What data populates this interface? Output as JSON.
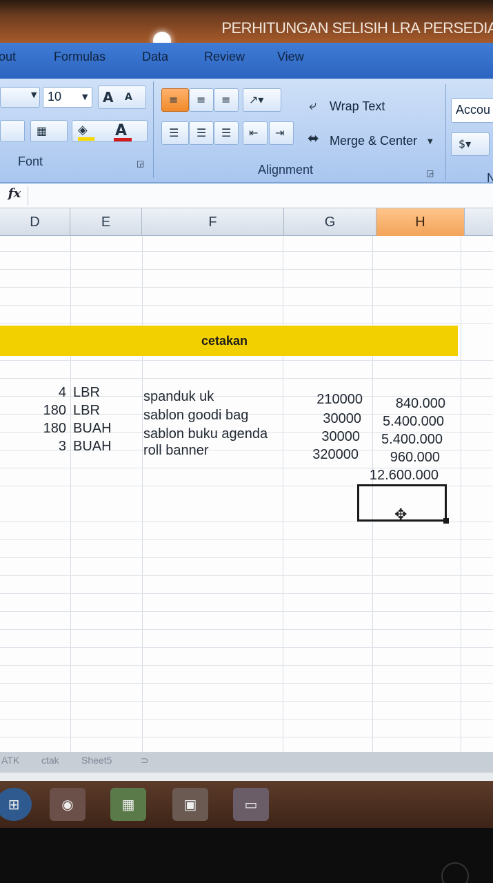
{
  "window": {
    "title": "PERHITUNGAN SELISIH LRA PERSEDIA"
  },
  "tabs": [
    "out",
    "Formulas",
    "Data",
    "Review",
    "View"
  ],
  "ribbon": {
    "font_size": "10",
    "font_group_label": "Font",
    "alignment_group_label": "Alignment",
    "wrap_text_label": "Wrap Text",
    "merge_center_label": "Merge & Center",
    "number_format_value": "Accou",
    "number_group_label_fragment": "N"
  },
  "formula_bar": {
    "fx_label": "fx",
    "value": ""
  },
  "columns": [
    "D",
    "E",
    "F",
    "G",
    "H"
  ],
  "selected_column": "H",
  "section_title": "cetakan",
  "rows": [
    {
      "qty": "4",
      "unit": "LBR",
      "item": "spanduk uk",
      "price": "210000",
      "total": "840.000"
    },
    {
      "qty": "180",
      "unit": "LBR",
      "item": "sablon goodi bag",
      "price": "30000",
      "total": "5.400.000"
    },
    {
      "qty": "180",
      "unit": "BUAH",
      "item": "sablon buku agenda",
      "price": "30000",
      "total": "5.400.000"
    },
    {
      "qty": "3",
      "unit": "BUAH",
      "item": "roll banner",
      "price": "320000",
      "total": "960.000"
    }
  ],
  "grand_total": "12.600.000",
  "sheet_tabs": [
    "ATK",
    "ctak",
    "Sheet5"
  ],
  "colors": {
    "header_yellow": "#f2d000",
    "selected_header": "#f2a45a",
    "ribbon_blue": "#3f7cd6"
  }
}
